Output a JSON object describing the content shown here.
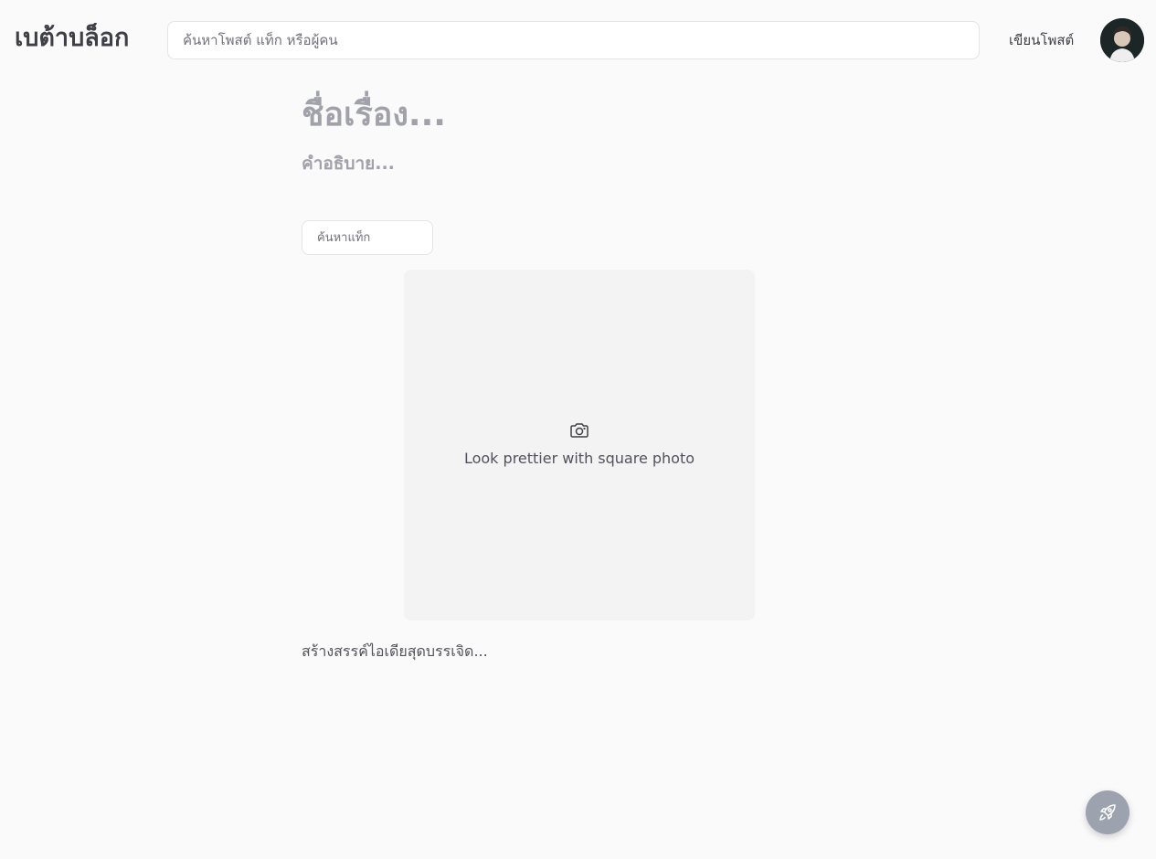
{
  "header": {
    "brand": "เบต้าบล็อก",
    "search_placeholder": "ค้นหาโพสต์ แท็ก หรือผู้คน",
    "write_label": "เขียนโพสต์",
    "avatar_icon": "user-avatar"
  },
  "editor": {
    "title_placeholder": "ชื่อเรื่อง...",
    "description_placeholder": "คำอธิบาย...",
    "tag_search_placeholder": "ค้นหาแท็ก",
    "photo_hint": "Look prettier with square photo",
    "photo_icon": "camera-icon",
    "body_placeholder": "สร้างสรรค์ไอเดียสุดบรรเจิด..."
  },
  "fab": {
    "icon": "rocket-icon"
  },
  "colors": {
    "background": "#fafafa",
    "placeholder_text": "#a1a1aa",
    "photo_area": "#f3f3f3",
    "fab": "#9ca3af"
  }
}
